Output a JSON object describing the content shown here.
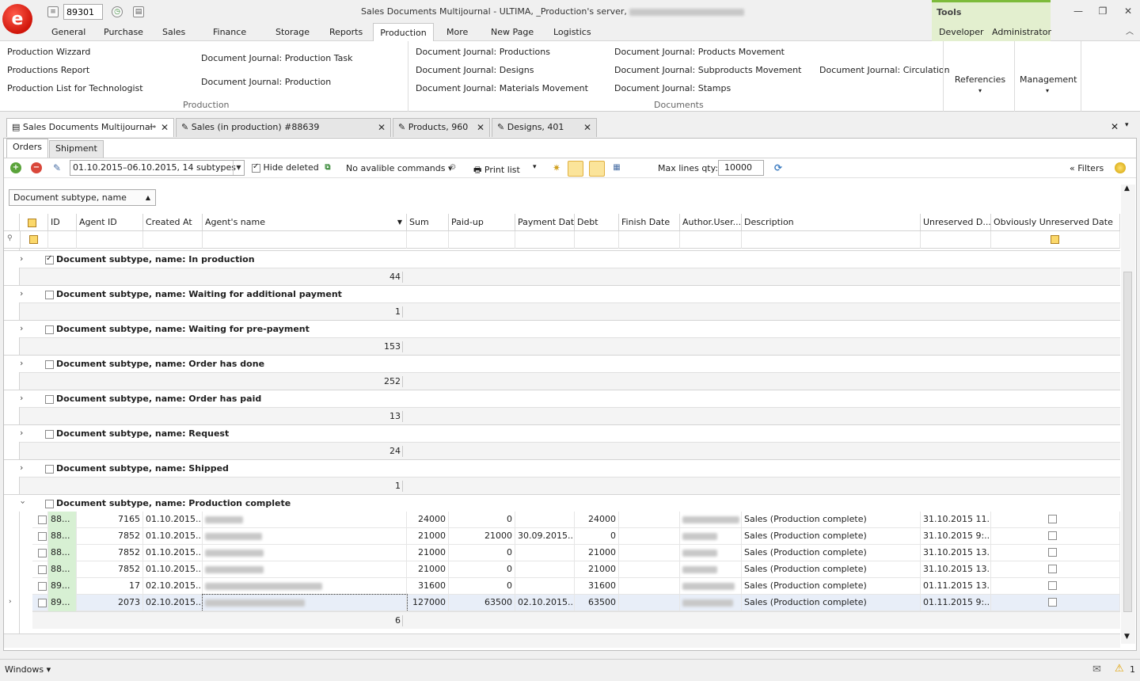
{
  "quick_access": {
    "doc_number": "89301"
  },
  "window": {
    "title": "Sales Documents Multijournal - ULTIMA, _Production's server,"
  },
  "menu_tabs": [
    "General",
    "Purchase",
    "Sales",
    "Finance",
    "Storage",
    "Reports",
    "Production",
    "More",
    "New Page",
    "Logistics"
  ],
  "context_tabs": {
    "group": "Tools",
    "tabs": [
      "Developer",
      "Administrator"
    ]
  },
  "ribbon": {
    "production_group": {
      "label": "Production",
      "items": [
        "Production Wizzard",
        "Productions Report",
        "Production List for Technologist",
        "Document Journal: Production Task",
        "Document Journal: Production"
      ]
    },
    "documents_group": {
      "label": "Documents",
      "items": [
        "Document Journal: Productions",
        "Document Journal: Designs",
        "Document Journal: Materials Movement",
        "Document Journal: Products Movement",
        "Document Journal: Subproducts Movement",
        "Document Journal: Stamps",
        "Document Journal: Circulation"
      ]
    },
    "references_label": "Referencies",
    "management_label": "Management"
  },
  "doc_tabs": [
    {
      "label": "Sales Documents Multijournal"
    },
    {
      "label": "Sales (in production) #88639"
    },
    {
      "label": "Products, 960"
    },
    {
      "label": "Designs, 401"
    }
  ],
  "sub_tabs": [
    "Orders",
    "Shipment"
  ],
  "toolbar": {
    "date_range": "01.10.2015–06.10.2015, 14 subtypes",
    "hide_deleted_label": "Hide deleted",
    "commands_label": "No avalible commands",
    "print_label": "Print list",
    "max_lines_label": "Max lines qty:",
    "max_lines_value": "10000",
    "filters_label": "Filters"
  },
  "group_by": "Document subtype, name",
  "columns": [
    "ID",
    "Agent ID",
    "Created At",
    "Agent's name",
    "Sum",
    "Paid-up",
    "Payment Date",
    "Debt",
    "Finish Date",
    "Author.User...",
    "Description",
    "Unreserved D...",
    "Obviously Unreserved Date"
  ],
  "groups": [
    {
      "label": "Document subtype, name: In production",
      "count": "44",
      "checked": true
    },
    {
      "label": "Document subtype, name: Waiting for additional payment",
      "count": "1",
      "checked": false
    },
    {
      "label": "Document subtype, name: Waiting for pre-payment",
      "count": "153",
      "checked": false
    },
    {
      "label": "Document subtype, name: Order has done",
      "count": "252",
      "checked": false
    },
    {
      "label": "Document subtype, name: Order has paid",
      "count": "13",
      "checked": false
    },
    {
      "label": "Document subtype, name: Request",
      "count": "24",
      "checked": false
    },
    {
      "label": "Document subtype, name: Shipped",
      "count": "1",
      "checked": false
    },
    {
      "label": "Document subtype, name: Production complete",
      "count": "6",
      "checked": false,
      "expanded": true
    }
  ],
  "rows": [
    {
      "id": "88...",
      "agent_id": "7165",
      "created": "01.10.2015...",
      "sum": "24000",
      "paid": "0",
      "pay_date": "",
      "debt": "24000",
      "desc": "Sales (Production complete)",
      "unreserved": "31.10.2015 11..."
    },
    {
      "id": "88...",
      "agent_id": "7852",
      "created": "01.10.2015...",
      "sum": "21000",
      "paid": "21000",
      "pay_date": "30.09.2015...",
      "debt": "0",
      "desc": "Sales (Production complete)",
      "unreserved": "31.10.2015 9:..."
    },
    {
      "id": "88...",
      "agent_id": "7852",
      "created": "01.10.2015...",
      "sum": "21000",
      "paid": "0",
      "pay_date": "",
      "debt": "21000",
      "desc": "Sales (Production complete)",
      "unreserved": "31.10.2015 13..."
    },
    {
      "id": "88...",
      "agent_id": "7852",
      "created": "01.10.2015...",
      "sum": "21000",
      "paid": "0",
      "pay_date": "",
      "debt": "21000",
      "desc": "Sales (Production complete)",
      "unreserved": "31.10.2015 13..."
    },
    {
      "id": "89...",
      "agent_id": "17",
      "created": "02.10.2015...",
      "sum": "31600",
      "paid": "0",
      "pay_date": "",
      "debt": "31600",
      "desc": "Sales (Production complete)",
      "unreserved": "01.11.2015 13..."
    },
    {
      "id": "89...",
      "agent_id": "2073",
      "created": "02.10.2015...",
      "sum": "127000",
      "paid": "63500",
      "pay_date": "02.10.2015...",
      "debt": "63500",
      "desc": "Sales (Production complete)",
      "unreserved": "01.11.2015 9:..."
    }
  ],
  "statusbar": {
    "windows_label": "Windows",
    "warning_count": "1"
  }
}
